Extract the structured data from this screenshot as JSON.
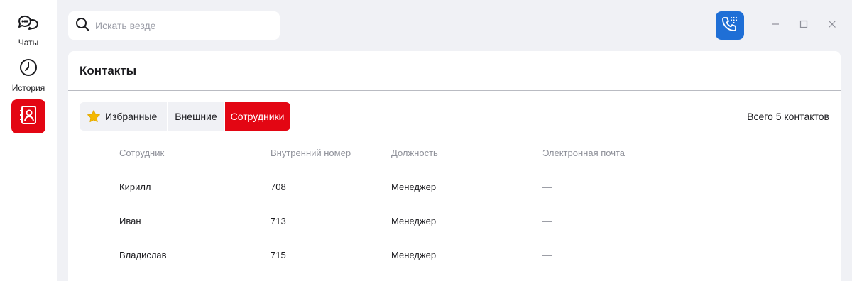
{
  "sidebar": {
    "items": [
      {
        "label": "Чаты",
        "icon": "chat-bubbles-icon"
      },
      {
        "label": "История",
        "icon": "clock-icon"
      },
      {
        "label": "",
        "icon": "contacts-book-icon",
        "active": true
      }
    ]
  },
  "search": {
    "placeholder": "Искать везде",
    "value": ""
  },
  "window_controls": [
    "minimize-icon",
    "maximize-icon",
    "close-icon"
  ],
  "colors": {
    "accent": "#e30613",
    "call_button": "#1f6fd6",
    "star": "#f5b800"
  },
  "contacts": {
    "title": "Контакты",
    "tabs": [
      {
        "label": "Избранные",
        "icon": "star-icon"
      },
      {
        "label": "Внешние"
      },
      {
        "label": "Сотрудники",
        "active": true
      }
    ],
    "total": "Всего 5 контактов",
    "columns": [
      "Сотрудник",
      "Внутренний номер",
      "Должность",
      "Электронная почта"
    ],
    "rows": [
      {
        "name": "Кирилл",
        "ext": "708",
        "position": "Менеджер",
        "email": "—"
      },
      {
        "name": "Иван",
        "ext": "713",
        "position": "Менеджер",
        "email": "—"
      },
      {
        "name": "Владислав",
        "ext": "715",
        "position": "Менеджер",
        "email": "—"
      }
    ]
  }
}
